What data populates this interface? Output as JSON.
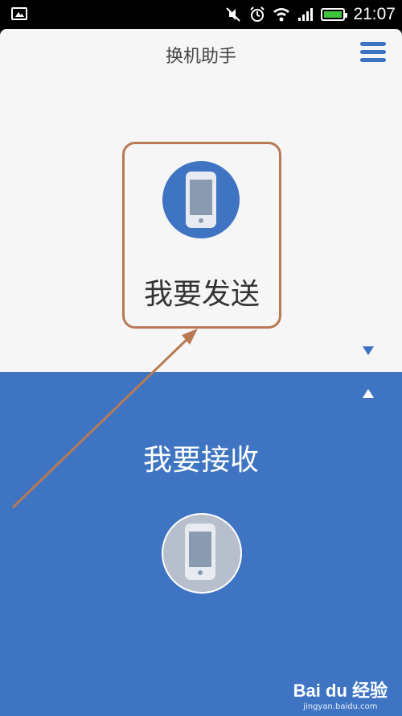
{
  "status_bar": {
    "time": "21:07",
    "icons": [
      "gallery-icon",
      "mute-icon",
      "alarm-icon",
      "wifi-icon",
      "signal-icon",
      "battery-icon"
    ]
  },
  "header": {
    "title": "换机助手",
    "menu_icon": "hamburger-menu-icon"
  },
  "send": {
    "label": "我要发送",
    "icon": "phone-icon",
    "expand_icon": "down-triangle-icon"
  },
  "receive": {
    "label": "我要接收",
    "icon": "phone-icon",
    "collapse_icon": "up-triangle-icon"
  },
  "watermark": {
    "logo": "Bai du 经验",
    "url": "jingyan.baidu.com"
  },
  "colors": {
    "accent": "#3e74c2",
    "annotation": "#b87a55",
    "top_panel_bg": "#f6f6f6"
  }
}
